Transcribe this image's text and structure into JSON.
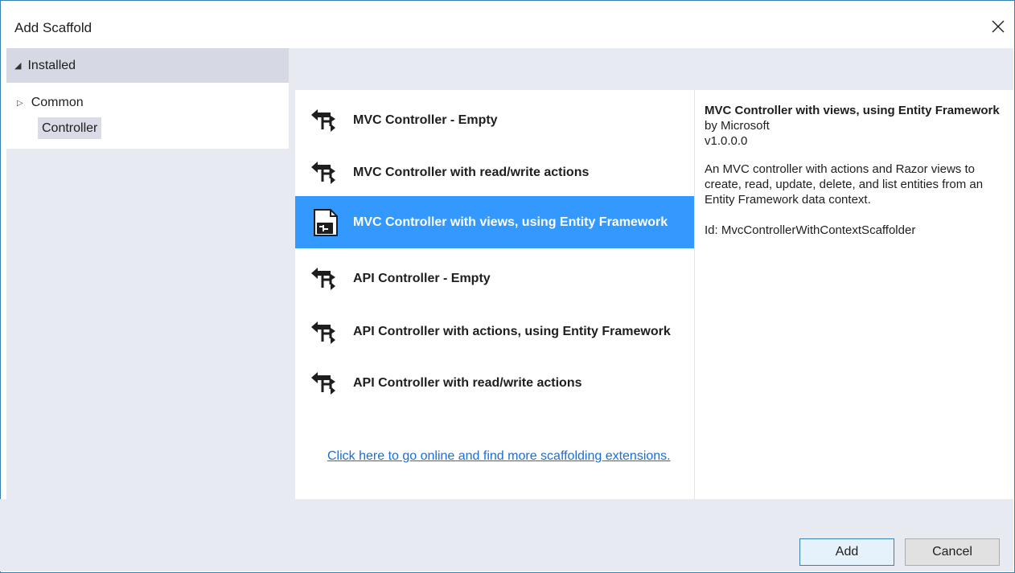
{
  "dialog": {
    "title": "Add Scaffold",
    "close_icon": "close-icon"
  },
  "sidebar": {
    "header": "Installed",
    "tree": [
      {
        "label": "Common",
        "expandable": true
      },
      {
        "label": "Controller",
        "selected": true
      }
    ]
  },
  "templates": {
    "items": [
      {
        "label": "MVC Controller - Empty",
        "icon": "controller-icon"
      },
      {
        "label": "MVC Controller with read/write actions",
        "icon": "controller-icon"
      },
      {
        "label": "MVC Controller with views, using Entity Framework",
        "icon": "document-controller-icon",
        "selected": true
      },
      {
        "label": "API Controller - Empty",
        "icon": "controller-icon"
      },
      {
        "label": "API Controller with actions, using Entity Framework",
        "icon": "controller-icon"
      },
      {
        "label": "API Controller with read/write actions",
        "icon": "controller-icon"
      }
    ],
    "online_link": "Click here to go online and find more scaffolding extensions."
  },
  "details": {
    "title": "MVC Controller with views, using Entity Framework",
    "author": "by Microsoft",
    "version": "v1.0.0.0",
    "description": "An MVC controller with actions and Razor views to create, read, update, delete, and list entities from an Entity Framework data context.",
    "id": "Id: MvcControllerWithContextScaffolder"
  },
  "footer": {
    "add_label": "Add",
    "cancel_label": "Cancel"
  },
  "colors": {
    "selection": "#3399ff",
    "link": "#1a6ed8",
    "panel_bg": "#e8eaf1",
    "accent_border": "#3c7fb1"
  }
}
